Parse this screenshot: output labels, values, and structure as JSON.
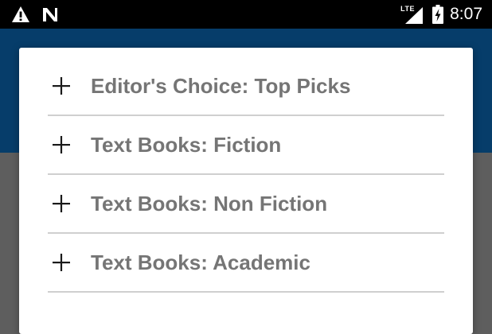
{
  "status_bar": {
    "network_label": "LTE",
    "time": "8:07",
    "icons": [
      "warning-icon",
      "n-notification-icon",
      "lte-signal-icon",
      "battery-charging-icon"
    ]
  },
  "colors": {
    "status_bar": "#000000",
    "app_bar": "#063d6a",
    "scrim": "#5e5e5e",
    "dialog": "#ffffff",
    "item_text": "#757575",
    "divider": "#cfcfcf"
  },
  "dialog": {
    "items": [
      {
        "icon": "plus-icon",
        "label": "Editor's Choice: Top Picks"
      },
      {
        "icon": "plus-icon",
        "label": "Text Books: Fiction"
      },
      {
        "icon": "plus-icon",
        "label": "Text Books: Non Fiction"
      },
      {
        "icon": "plus-icon",
        "label": "Text Books: Academic"
      }
    ]
  }
}
